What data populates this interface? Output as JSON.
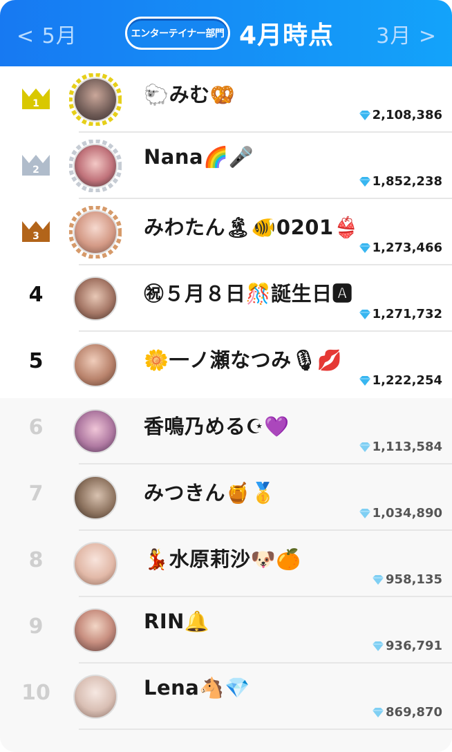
{
  "header": {
    "prev_month": "< 5月",
    "next_month": "3月 >",
    "category": "エンターテイナー部門",
    "title": "4月時点"
  },
  "colors": {
    "header_start": "#1779f2",
    "header_end": "#13a3fa",
    "gold": "#d9c800",
    "silver": "#b0bccb",
    "bronze": "#b2641a",
    "gem": "#38b6f0"
  },
  "ranking": [
    {
      "rank": "1",
      "name": "🐑みむ🥨",
      "score": "2,108,386",
      "badge": "gold-crown"
    },
    {
      "rank": "2",
      "name": "Nana🌈🎤",
      "score": "1,852,238",
      "badge": "silver-crown"
    },
    {
      "rank": "3",
      "name": "みわたん🏝🐠0201👙",
      "score": "1,273,466",
      "badge": "bronze-crown"
    },
    {
      "rank": "4",
      "name": "㊗５月８日🎊誕生日🅰",
      "score": "1,271,732"
    },
    {
      "rank": "5",
      "name": "🌼一ノ瀬なつみ🎙💋",
      "score": "1,222,254"
    },
    {
      "rank": "6",
      "name": "香鳴乃める☪💜",
      "score": "1,113,584"
    },
    {
      "rank": "7",
      "name": "みつきん🍯🥇",
      "score": "1,034,890"
    },
    {
      "rank": "8",
      "name": "💃水原莉沙🐶🍊",
      "score": "958,135"
    },
    {
      "rank": "9",
      "name": "RIN🔔",
      "score": "936,791"
    },
    {
      "rank": "10",
      "name": "Lena🐴💎",
      "score": "869,870"
    }
  ]
}
